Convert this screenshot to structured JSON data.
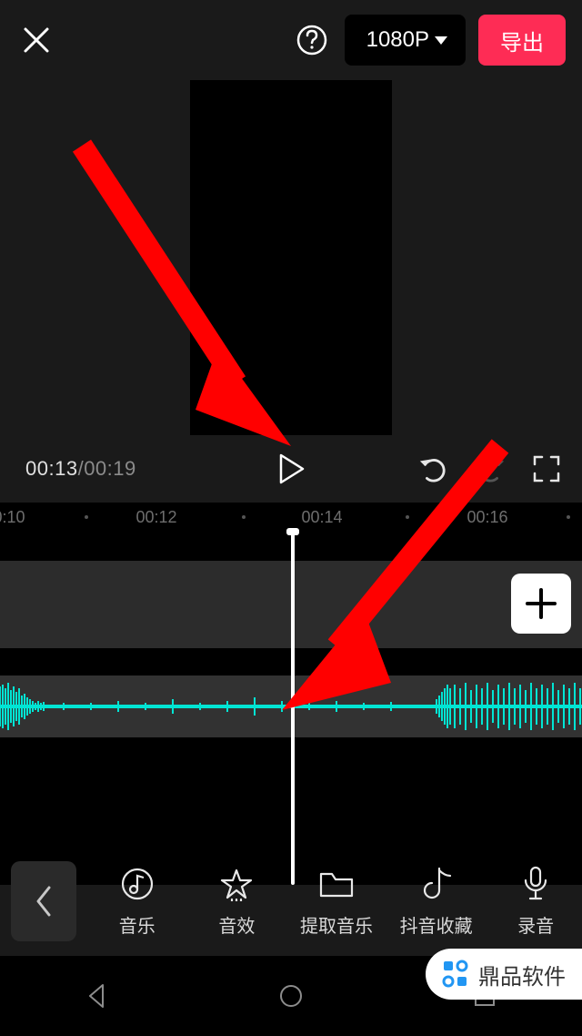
{
  "header": {
    "resolution_label": "1080P",
    "export_label": "导出"
  },
  "transport": {
    "current_time": "00:13",
    "total_time": "00:19"
  },
  "ruler": {
    "ticks": [
      "0:10",
      "00:12",
      "00:14",
      "00:16"
    ]
  },
  "toolbar": {
    "items": [
      {
        "icon": "music-note",
        "label": "音乐"
      },
      {
        "icon": "star-sound",
        "label": "音效"
      },
      {
        "icon": "folder",
        "label": "提取音乐"
      },
      {
        "icon": "douyin",
        "label": "抖音收藏"
      },
      {
        "icon": "mic",
        "label": "录音"
      }
    ]
  },
  "watermark": {
    "text": "鼎品软件"
  },
  "colors": {
    "accent": "#fe2c55",
    "wave": "#00e5d4"
  }
}
